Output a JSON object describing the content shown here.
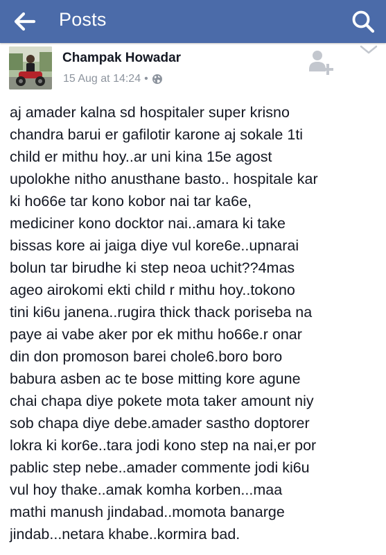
{
  "header": {
    "title": "Posts",
    "back_icon": "back-arrow-icon",
    "search_icon": "search-icon",
    "background_color": "#4b6ba9"
  },
  "post": {
    "author": "Champak Howadar",
    "date": "15 Aug at 14:24",
    "separator": "•",
    "privacy_icon": "globe-icon",
    "add_friend_icon": "add-friend-icon",
    "options_icon": "chevron-down-icon",
    "lines": [
      "aj amader kalna sd hospitaler super krisno",
      "chandra barui er gafilotir karone aj sokale 1ti",
      "child er mithu hoy..ar uni kina 15e agost",
      "upolokhe nitho anusthane basto.. hospitale kar",
      "ki ho66e tar kono kobor nai tar ka6e,",
      "mediciner kono docktor nai..amara ki take",
      "bissas kore ai jaiga diye vul kore6e..upnarai",
      "bolun tar birudhe ki step neoa uchit??4mas",
      "ageo airokomi ekti child r mithu hoy..tokono",
      "tini ki6u janena..rugira thick thack poriseba na",
      "paye ai vabe aker por ek mithu ho66e.r onar",
      "din don promoson barei chole6.boro boro",
      "babura asben ac te bose mitting kore agune",
      "chai chapa diye pokete mota taker amount niy",
      "sob chapa diye debe.amader sastho doptorer",
      "lokra ki kor6e..tara jodi kono step na nai,er por",
      "pablic step nebe..amader  commente jodi ki6u",
      "vul hoy thake..amak komha korben...maa",
      "mathi manush jindabad..momota banarge",
      "jindab...netara khabe..kormira bad."
    ]
  }
}
